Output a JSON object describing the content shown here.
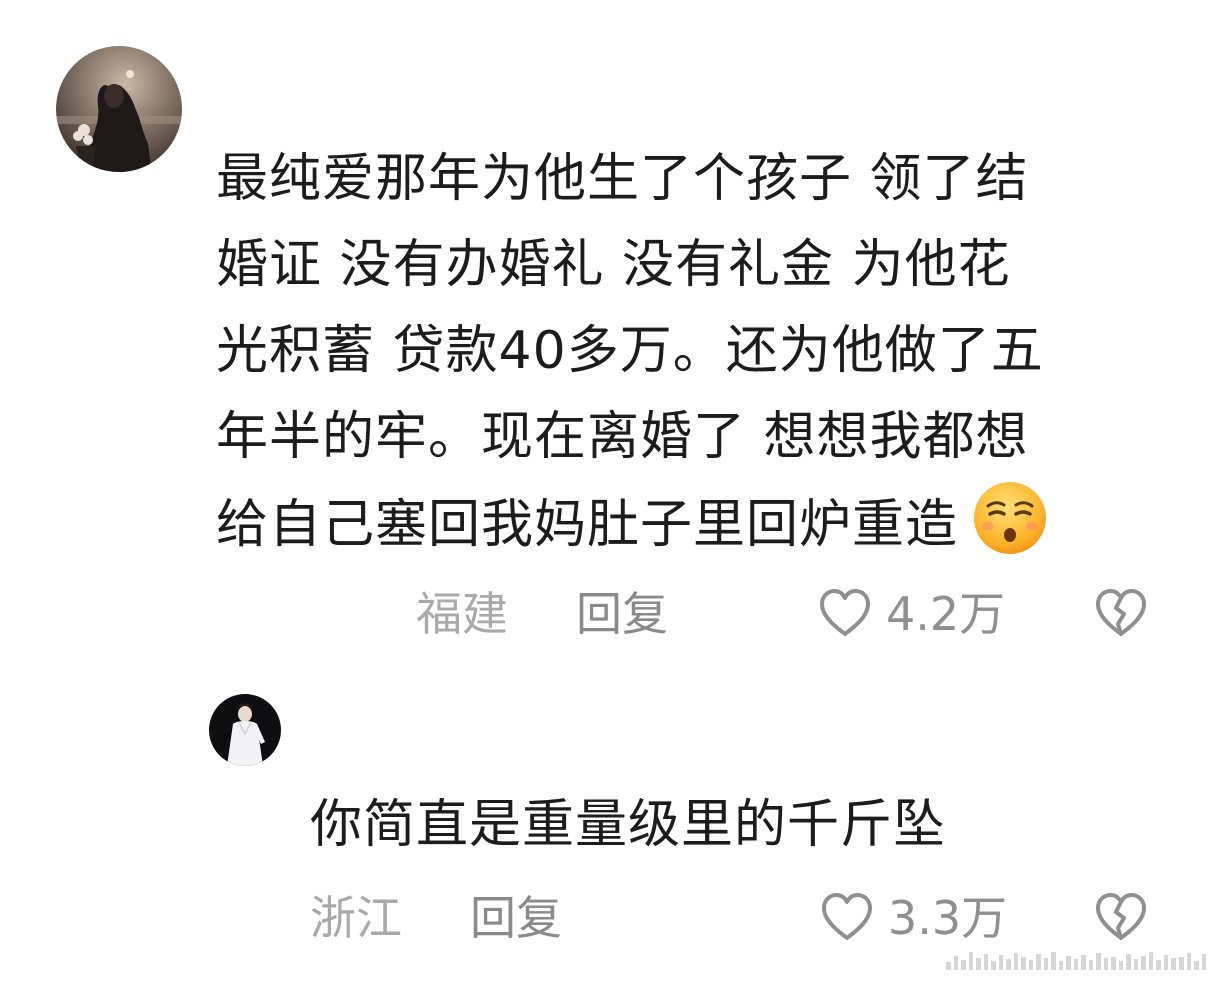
{
  "comments": [
    {
      "text_lines": [
        "最纯爱那年为他生了个孩子 领了结",
        "婚证 没有办婚礼 没有礼金  为他花",
        "光积蓄 贷款40多万。还为他做了五",
        "年半的牢。现在离婚了 想想我都想",
        "给自己塞回我妈肚子里回炉重造"
      ],
      "emoji": "unamused-face-emoji",
      "location": "福建",
      "reply_label": "回复",
      "likes": "4.2万"
    },
    {
      "text_lines": [
        "你简直是重量级里的千斤坠"
      ],
      "location": "浙江",
      "reply_label": "回复",
      "likes": "3.3万"
    }
  ],
  "icons": {
    "like": "heart-outline-icon",
    "dislike": "broken-heart-icon"
  },
  "colors": {
    "text": "#1c1c1c",
    "meta_text": "#a9a9a9",
    "icon_stroke": "#8f8f8f",
    "emoji_face": "#f7a521"
  }
}
